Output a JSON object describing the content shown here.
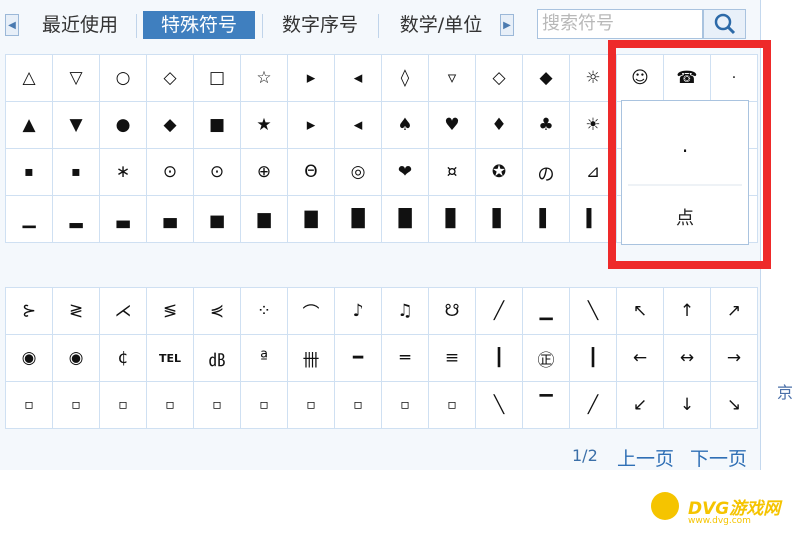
{
  "tabs": {
    "recent": "最近使用",
    "special": "特殊符号",
    "number": "数字序号",
    "math": "数学/单位"
  },
  "search": {
    "placeholder": "搜索符号"
  },
  "grid1": [
    [
      "△",
      "▽",
      "○",
      "◇",
      "□",
      "☆",
      "▸",
      "◂",
      "◊",
      "▿",
      "◇",
      "◆",
      "☼",
      "☺",
      "☎",
      "·"
    ],
    [
      "▲",
      "▼",
      "●",
      "◆",
      "■",
      "★",
      "▸",
      "◂",
      "♠",
      "♥",
      "♦",
      "♣",
      "☀",
      "",
      "",
      ""
    ],
    [
      "▪",
      "▪",
      "∗",
      "⊙",
      "⊙",
      "⊕",
      "Θ",
      "◎",
      "❤",
      "¤",
      "✪",
      "の",
      "⊿",
      "",
      "",
      ""
    ],
    [
      "▁",
      "▂",
      "▃",
      "▄",
      "▅",
      "▆",
      "▇",
      "█",
      "█",
      "▊",
      "▋",
      "▌",
      "▍",
      "",
      "",
      ""
    ]
  ],
  "grid2": [
    [
      "⊱",
      "≷",
      "⋌",
      "≶",
      "⋞",
      "⁘",
      "⌒",
      "♪",
      "♫",
      "☋",
      "╱",
      "▁",
      "╲",
      "↖",
      "↑",
      "↗"
    ],
    [
      "◉",
      "◉",
      "¢",
      "TEL",
      "㏈",
      "ª",
      "卌",
      "━",
      "═",
      "≡",
      "┃",
      "㊣",
      "┃",
      "←",
      "↔",
      "→"
    ],
    [
      "▫",
      "▫",
      "▫",
      "▫",
      "▫",
      "▫",
      "▫",
      "▫",
      "▫",
      "▫",
      "╲",
      "▔",
      "╱",
      "↙",
      "↓",
      "↘"
    ]
  ],
  "popup": {
    "glyph": "·",
    "name": "点"
  },
  "pagination": {
    "info": "1/2",
    "prev": "上一页",
    "next": "下一页"
  },
  "side_text": "京",
  "watermark": {
    "name": "DVG游戏网",
    "url": "www.dvg.com"
  },
  "colors": {
    "accent": "#3f7fbf",
    "highlight": "#ee2a2a",
    "link": "#2f6fb5"
  }
}
